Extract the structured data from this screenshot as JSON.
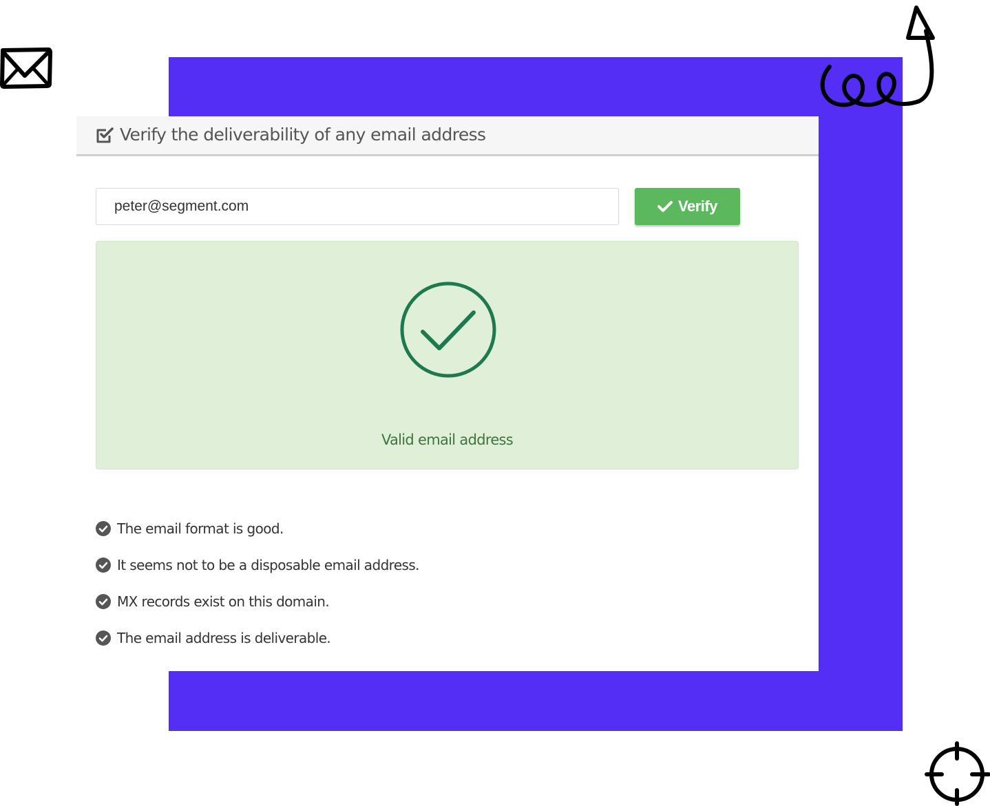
{
  "header": {
    "title": "Verify the deliverability of any email address",
    "icon": "checkbox-checked-icon"
  },
  "form": {
    "email_value": "peter@segment.com",
    "verify_label": "Verify"
  },
  "result": {
    "status_text": "Valid email address",
    "icon": "check-circle-icon"
  },
  "checks": [
    {
      "text": "The email format is good."
    },
    {
      "text": "It seems not to be a disposable email address."
    },
    {
      "text": "MX records exist on this domain."
    },
    {
      "text": "The email address is deliverable."
    }
  ],
  "decorations": {
    "envelope": "envelope-doodle-icon",
    "arrow": "loop-arrow-doodle-icon",
    "crosshair": "crosshair-doodle-icon"
  },
  "colors": {
    "frame": "#552ef6",
    "success_button": "#5cb85c",
    "success_bg": "#dfefd8",
    "success_text": "#3c763d",
    "check_circle": "#1e7a4e"
  }
}
